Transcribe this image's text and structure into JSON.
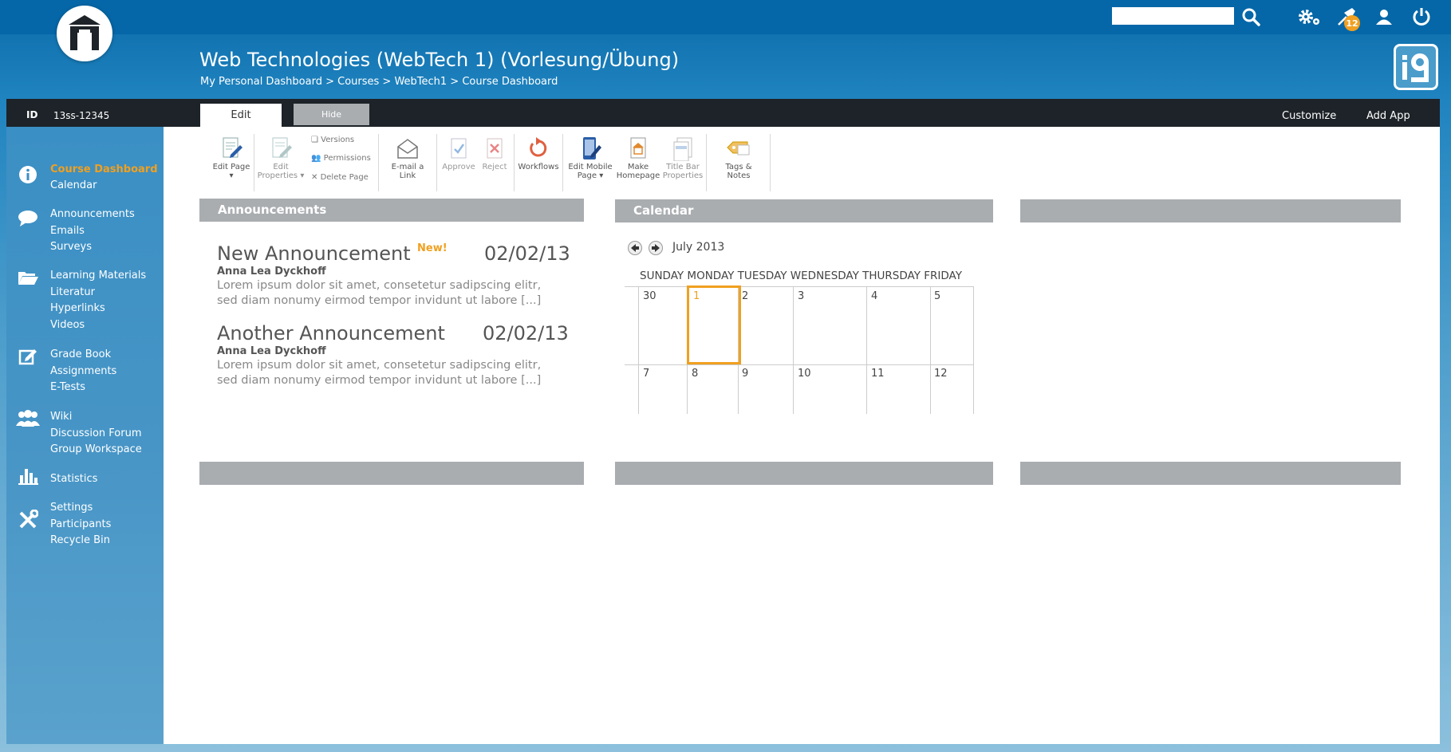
{
  "header": {
    "search": {
      "value": "",
      "placeholder": ""
    },
    "icons": [
      "settings-icon",
      "pin-icon",
      "user-icon",
      "power-icon"
    ],
    "notification_count": "12",
    "title": "Web Technologies (WebTech 1) (Vorlesung/Übung)",
    "breadcrumb": "My Personal Dashboard > Courses > WebTech1 > Course Dashboard"
  },
  "bar": {
    "id_label": "ID",
    "id_value": "13ss-12345",
    "tab_edit": "Edit",
    "tab_hide": "Hide",
    "customize": "Customize",
    "add_app": "Add App"
  },
  "sidebar": {
    "groups": [
      {
        "icon": "info-icon",
        "items": [
          "Course Dashboard",
          "Calendar"
        ]
      },
      {
        "icon": "speech-bubble-icon",
        "items": [
          "Announcements",
          "Emails",
          "Surveys"
        ]
      },
      {
        "icon": "folder-icon",
        "items": [
          "Learning Materials",
          "Literatur",
          "Hyperlinks",
          "Videos"
        ]
      },
      {
        "icon": "edit-icon",
        "items": [
          "Grade Book",
          "Assignments",
          "E-Tests"
        ]
      },
      {
        "icon": "group-icon",
        "items": [
          "Wiki",
          "Discussion Forum",
          "Group Workspace"
        ]
      },
      {
        "icon": "bar-chart-icon",
        "items": [
          "Statistics"
        ]
      },
      {
        "icon": "tools-icon",
        "items": [
          "Settings",
          "Participants",
          "Recycle Bin"
        ]
      }
    ],
    "active": "Course Dashboard"
  },
  "ribbon": {
    "edit_page": "Edit Page",
    "edit_properties": [
      "Edit",
      "Properties"
    ],
    "versions": "Versions",
    "permissions": "Permissions",
    "delete_page": "Delete Page",
    "email_link": [
      "E-mail a",
      "Link"
    ],
    "approve": "Approve",
    "reject": "Reject",
    "workflows": "Workflows",
    "edit_mobile": [
      "Edit Mobile",
      "Page"
    ],
    "make_homepage": [
      "Make",
      "Homepage"
    ],
    "title_bar": [
      "Title Bar",
      "Properties"
    ],
    "tags_notes": [
      "Tags &",
      "Notes"
    ]
  },
  "announcements": {
    "heading": "Announcements",
    "items": [
      {
        "title": "New Announcement",
        "badge": "New!",
        "date": "02/02/13",
        "author": "Anna Lea Dyckhoff",
        "body1": "Lorem ipsum dolor sit amet, consetetur sadipscing elitr,",
        "body2": "sed diam nonumy eirmod tempor invidunt ut labore  [...]"
      },
      {
        "title": "Another Announcement",
        "badge": "",
        "date": "02/02/13",
        "author": "Anna Lea Dyckhoff",
        "body1": "Lorem ipsum dolor sit amet, consetetur sadipscing elitr,",
        "body2": "sed diam nonumy eirmod tempor invidunt ut labore  [...]"
      }
    ]
  },
  "calendar": {
    "heading": "Calendar",
    "month": "July 2013",
    "days": "SUNDAY MONDAY TUESDAY WEDNESDAY THURSDAY FRIDAY",
    "week1": [
      "30",
      "1",
      "2",
      "3",
      "4",
      "5"
    ],
    "week2": [
      "7",
      "8",
      "9",
      "10",
      "11",
      "12"
    ],
    "today": "1"
  },
  "colors": {
    "accent": "#f0a020",
    "topbar": "#0567a7",
    "panel_head": "#a9adb0",
    "dark_bar": "#1d2328"
  }
}
